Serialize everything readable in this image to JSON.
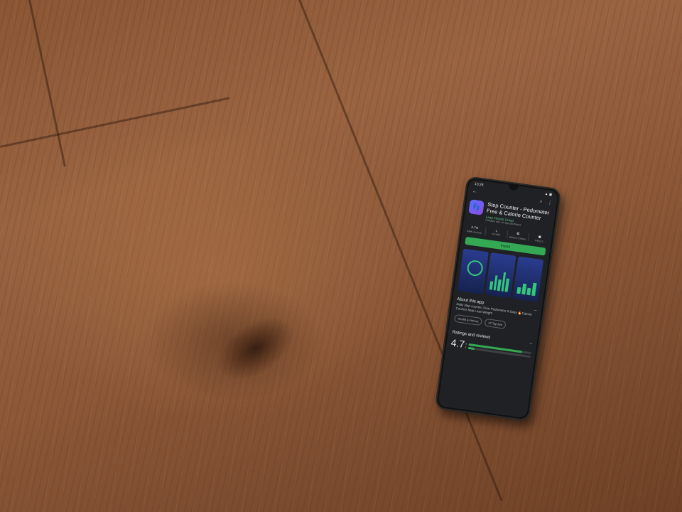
{
  "status": {
    "time": "13:26"
  },
  "app": {
    "title": "Step Counter - Pedometer Free & Calorie Counter",
    "developer": "Leap Fitness Group",
    "ads": "Contains ads • In-app purchases",
    "icon": "footsteps-icon",
    "icon_colors": [
      "#5b6cff",
      "#8a4fe0"
    ]
  },
  "stats": [
    {
      "value": "4.7★",
      "sub": "349K reviews"
    },
    {
      "value": "8.3 MB",
      "sub": ""
    },
    {
      "value": "",
      "sub": "Editors' Choice"
    },
    {
      "value": "",
      "sub": "PEGI 3"
    }
  ],
  "install_label": "Install",
  "install_color": "#34a853",
  "about": {
    "title": "About this app",
    "description": "Daily step counter, Free Pedometer & Easy 🔥Calorie Counter help Lose Weight"
  },
  "chips": [
    "Health & Fitness",
    "#7 Top free"
  ],
  "ratings": {
    "title": "Ratings and reviews",
    "score": "4.7",
    "bars": [
      {
        "label": "5",
        "fill": 0.85
      },
      {
        "label": "4",
        "fill": 0.1
      }
    ]
  }
}
